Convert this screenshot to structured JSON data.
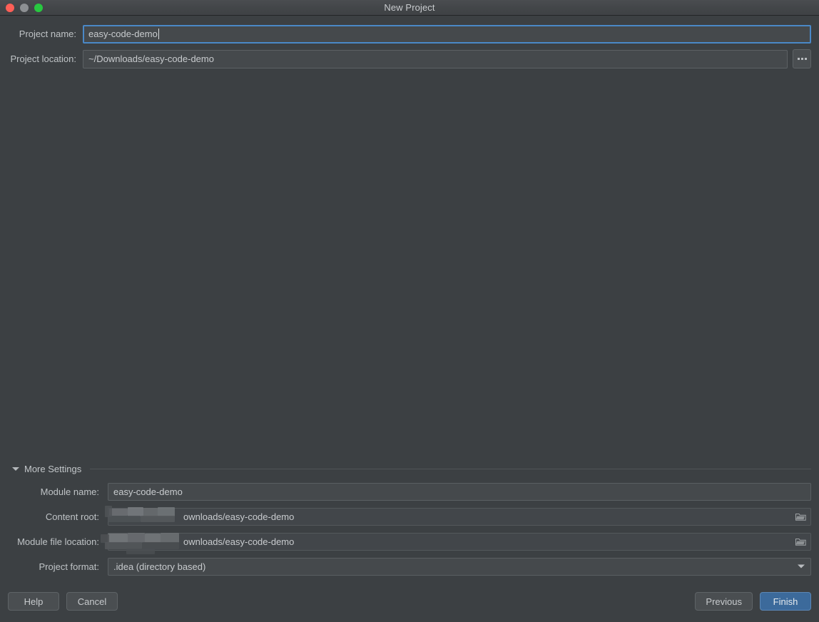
{
  "window": {
    "title": "New Project",
    "traffic_lights": [
      {
        "name": "close-button",
        "color": "#ff5f57"
      },
      {
        "name": "minimize-button",
        "color": "#8d9093"
      },
      {
        "name": "maximize-button",
        "color": "#28c840"
      }
    ]
  },
  "form": {
    "project_name": {
      "label": "Project name:",
      "value": "easy-code-demo",
      "focused": true
    },
    "project_location": {
      "label": "Project location:",
      "value": "~/Downloads/easy-code-demo",
      "browse_icon": "ellipsis-icon"
    }
  },
  "more_settings": {
    "title": "More Settings",
    "expanded": true,
    "collapse_icon": "triangle-down-icon",
    "rows": [
      {
        "label": "Module name:",
        "value": "easy-code-demo",
        "type": "text",
        "redacted": false,
        "trailing_icon": ""
      },
      {
        "label": "Content root:",
        "value": "ownloads/easy-code-demo",
        "type": "path",
        "redacted": true,
        "trailing_icon": "folder-icon"
      },
      {
        "label": "Module file location:",
        "value": "ownloads/easy-code-demo",
        "type": "path",
        "redacted": true,
        "trailing_icon": "folder-icon"
      },
      {
        "label": "Project format:",
        "value": ".idea (directory based)",
        "type": "select",
        "redacted": false,
        "trailing_icon": "chevron-down-icon"
      }
    ]
  },
  "footer": {
    "help_label": "Help",
    "cancel_label": "Cancel",
    "previous_label": "Previous",
    "finish_label": "Finish"
  },
  "colors": {
    "background": "#3c4043",
    "titlebar": "#43464a",
    "field_bg": "#45494c",
    "field_border": "#5c6164",
    "focus_border": "#4a88c7",
    "text": "#bfc3c6",
    "primary_button": "#3c6a9b"
  }
}
